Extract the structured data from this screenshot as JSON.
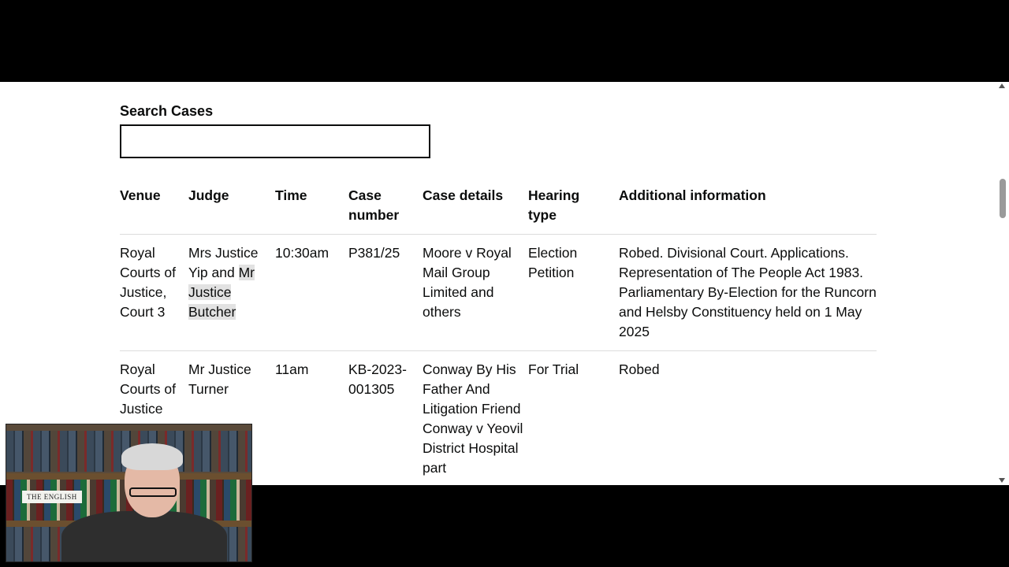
{
  "search": {
    "label": "Search Cases",
    "value": ""
  },
  "table": {
    "headers": [
      "Venue",
      "Judge",
      "Time",
      "Case\nnumber",
      "Case details",
      "Hearing\ntype",
      "Additional information"
    ],
    "rows": [
      {
        "venue": "Royal Courts of Justice, Court 3",
        "judge_prefix": "Mrs Justice Yip and ",
        "judge_highlight": "Mr Justice Butcher",
        "time": "10:30am",
        "case_number": "P381/25",
        "case_details": "Moore v Royal Mail Group Limited and others",
        "hearing_type": "Election Petition",
        "additional_info": "Robed. Divisional Court. Applications. Representation of The People Act 1983. Parliamentary By-Election for the Runcorn and Helsby Constituency held on 1 May 2025"
      },
      {
        "venue": "Royal Courts of Justice",
        "judge_prefix": "Mr Justice Turner",
        "judge_highlight": "",
        "time": "11am",
        "case_number": "KB-2023-001305",
        "case_details": "Conway By His Father And Litigation Friend Conway v Yeovil District Hospital part",
        "hearing_type": "For Trial",
        "additional_info": "Robed"
      }
    ]
  },
  "webcam": {
    "book_label": "THE ENGLISH"
  }
}
